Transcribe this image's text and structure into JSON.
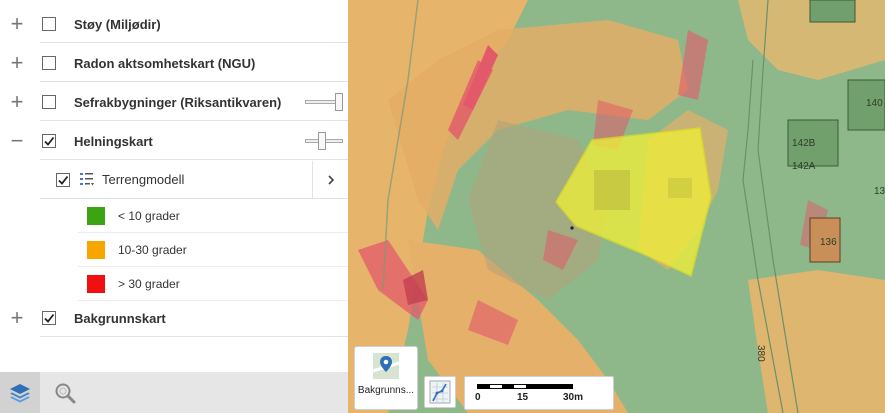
{
  "layers": [
    {
      "label": "Støy (Miljødir)",
      "expand": "+",
      "checked": false
    },
    {
      "label": "Radon aktsomhetskart (NGU)",
      "expand": "+",
      "checked": false
    },
    {
      "label": "Sefrakbygninger (Riksantikvaren)",
      "expand": "+",
      "checked": false,
      "opacity": 1.0
    },
    {
      "label": "Helningskart",
      "expand": "−",
      "checked": true,
      "opacity": 0.45
    },
    {
      "label": "Bakgrunnskart",
      "expand": "+",
      "checked": true
    }
  ],
  "sublayer": {
    "label": "Terrengmodell",
    "checked": true
  },
  "legend": [
    {
      "label": "< 10 grader",
      "color": "#3aa412"
    },
    {
      "label": "10-30 grader",
      "color": "#f7a600"
    },
    {
      "label": "> 30 grader",
      "color": "#f01010"
    }
  ],
  "toolbar": {
    "layers_icon": "layers-icon",
    "search_icon": "search-icon"
  },
  "map": {
    "basemap_button_label": "Bakgrunns...",
    "scale_labels": [
      "0",
      "15",
      "30m"
    ],
    "house_labels": [
      "140",
      "142B",
      "142A",
      "136",
      "13",
      "380"
    ]
  },
  "colors": {
    "slope_low": "#8eb88a",
    "slope_mid": "#e7b46c",
    "slope_high": "#e2596a",
    "selection": "#eeee3a"
  }
}
